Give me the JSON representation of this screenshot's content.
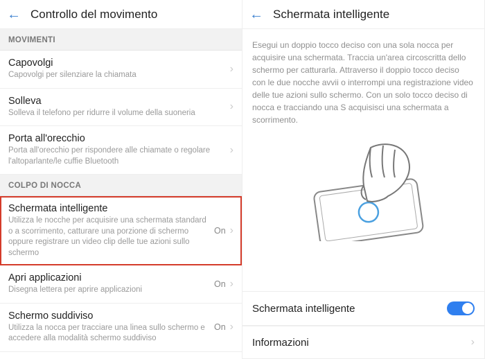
{
  "left": {
    "title": "Controllo del movimento",
    "sections": [
      {
        "header": "MOVIMENTI",
        "items": [
          {
            "label": "Capovolgi",
            "desc": "Capovolgi per silenziare la chiamata"
          },
          {
            "label": "Solleva",
            "desc": "Solleva il telefono per ridurre il volume della suoneria"
          },
          {
            "label": "Porta all'orecchio",
            "desc": "Porta all'orecchio per rispondere alle chiamate o regolare l'altoparlante/le cuffie Bluetooth"
          }
        ]
      },
      {
        "header": "COLPO DI NOCCA",
        "items": [
          {
            "label": "Schermata intelligente",
            "desc": "Utilizza le nocche per acquisire una schermata standard o a scorrimento, catturare una porzione di schermo oppure registrare un video clip delle tue azioni sullo schermo",
            "status": "On",
            "highlight": true
          },
          {
            "label": "Apri applicazioni",
            "desc": "Disegna lettera per aprire applicazioni",
            "status": "On"
          },
          {
            "label": "Schermo suddiviso",
            "desc": "Utilizza la nocca per tracciare una linea sullo schermo e accedere alla modalità schermo suddiviso",
            "status": "On"
          }
        ]
      }
    ]
  },
  "right": {
    "title": "Schermata intelligente",
    "intro": "Esegui un doppio tocco deciso con una sola nocca per acquisire una schermata. Traccia un'area circoscritta dello schermo per catturarla. Attraverso il doppio tocco deciso con le due nocche avvii o interrompi una registrazione video delle tue azioni sullo schermo. Con un solo tocco deciso di nocca e tracciando una S acquisisci una schermata a scorrimento.",
    "toggle_label": "Schermata intelligente",
    "toggle_on": true,
    "info_label": "Informazioni"
  }
}
